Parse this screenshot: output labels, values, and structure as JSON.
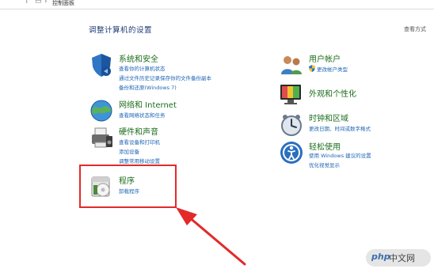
{
  "breadcrumb": "控制面板",
  "heading": "调整计算机的设置",
  "view_by": "查看方式",
  "categories": [
    {
      "title": "系统和安全",
      "links": [
        "查看你的计算机状态",
        "通过文件历史记录保存你的文件备份副本",
        "备份和还原(Windows 7)"
      ],
      "icon": "shield-icon"
    },
    {
      "title": "网络和 Internet",
      "links": [
        "查看网络状态和任务"
      ],
      "icon": "globe-network-icon"
    },
    {
      "title": "硬件和声音",
      "links": [
        "查看设备和打印机",
        "添加设备",
        "调整常用移动设置"
      ],
      "icon": "printer-speaker-icon"
    },
    {
      "title": "程序",
      "links": [
        "卸载程序"
      ],
      "icon": "program-disc-icon"
    },
    {
      "title": "用户帐户",
      "links": [
        "更改帐户类型"
      ],
      "icon": "users-icon"
    },
    {
      "title": "外观和个性化",
      "links": [],
      "icon": "monitor-palette-icon"
    },
    {
      "title": "时钟和区域",
      "links": [
        "更改日期、时间或数字格式"
      ],
      "icon": "clock-globe-icon"
    },
    {
      "title": "轻松使用",
      "links": [
        "使用 Windows 建议的设置",
        "优化视觉显示"
      ],
      "icon": "accessibility-icon"
    }
  ],
  "watermark": {
    "logo": "php",
    "text": "中文网"
  },
  "colors": {
    "title_green": "#1c6e1c",
    "link_blue": "#1e66b4",
    "heading": "#1f3d78",
    "highlight_red": "#e32a2a"
  }
}
